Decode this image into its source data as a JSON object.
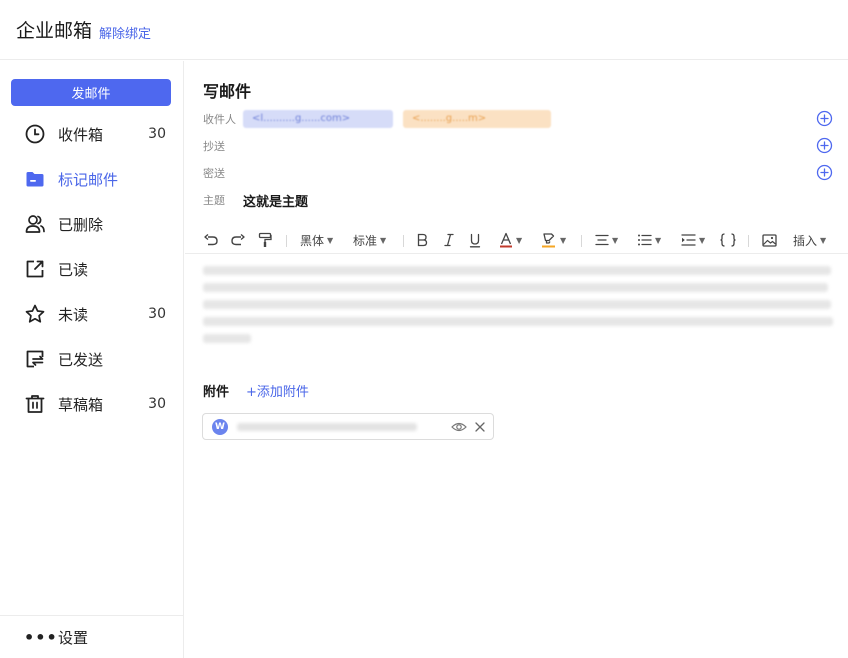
{
  "header": {
    "title": "企业邮箱",
    "unbind_link": "解除绑定"
  },
  "sidebar": {
    "compose_button": "发邮件",
    "items": [
      {
        "label": "收件箱",
        "count": "30",
        "icon": "clock-icon"
      },
      {
        "label": "标记邮件",
        "count": "",
        "icon": "folder-icon",
        "active": true
      },
      {
        "label": "已删除",
        "count": "",
        "icon": "users-icon"
      },
      {
        "label": "已读",
        "count": "",
        "icon": "external-link-icon"
      },
      {
        "label": "未读",
        "count": "30",
        "icon": "star-icon"
      },
      {
        "label": "已发送",
        "count": "",
        "icon": "sent-box-icon"
      },
      {
        "label": "草稿箱",
        "count": "30",
        "icon": "trash-icon"
      }
    ],
    "settings": {
      "icon": "•••",
      "label": "设置"
    }
  },
  "compose": {
    "title": "写邮件",
    "recipients_label": "收件人",
    "recipients": [
      "<l..........g......com>",
      "<........g.....m>"
    ],
    "cc_label": "抄送",
    "bcc_label": "密送",
    "subject_label": "主题",
    "subject_value": "这就是主题"
  },
  "toolbar": {
    "font_family": "黑体",
    "font_size": "标准",
    "insert": "插入",
    "text_color": "#c0392b",
    "highlight_color": "#f5a623"
  },
  "attachment": {
    "label": "附件",
    "add_link": "+添加附件",
    "file_badge": "W",
    "file_name": "..........."
  },
  "colors": {
    "accent": "#4e68ef",
    "link": "#4a66e8"
  }
}
